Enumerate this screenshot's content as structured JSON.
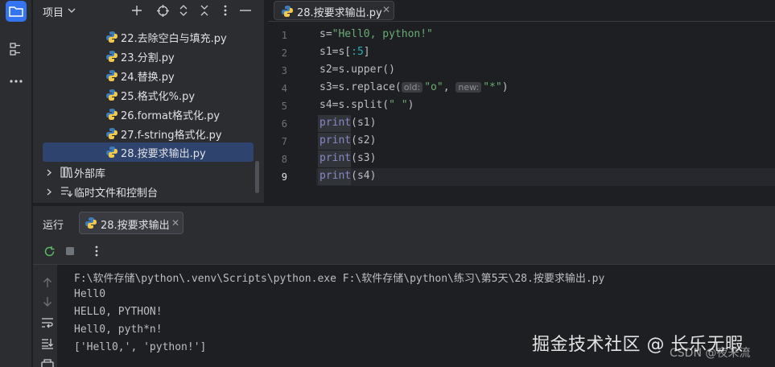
{
  "project_panel": {
    "title": "项目",
    "files": [
      "22.去除空白与填充.py",
      "23.分割.py",
      "24.替换.py",
      "25.格式化%.py",
      "26.format格式化.py",
      "27.f-string格式化.py",
      "28.按要求输出.py"
    ],
    "selected_file": "28.按要求输出.py",
    "external_libs": "外部库",
    "scratches": "临时文件和控制台"
  },
  "editor": {
    "tab_label": "28.按要求输出.py",
    "line_numbers": [
      "1",
      "2",
      "3",
      "4",
      "5",
      "6",
      "7",
      "8",
      "9"
    ],
    "current_line": "9",
    "code": {
      "l1_a": "s=",
      "l1_str": "\"Hell0, python!\"",
      "l2_a": "s1=s[",
      "l2_num": ":5",
      "l2_b": "]",
      "l3": "s2=s.upper()",
      "l4_a": "s3=s.replace(",
      "l4_hint1": "old:",
      "l4_str1": "\"o\"",
      "l4_comma": ",",
      "l4_hint2": "new:",
      "l4_str2": "\"*\"",
      "l4_b": ")",
      "l5_a": "s4=s.split(",
      "l5_str": "\" \"",
      "l5_b": ")",
      "print_kw": "print",
      "l6_arg": "(s1)",
      "l7_arg": "(s2)",
      "l8_arg": "(s3)",
      "l9_arg": "(s4)"
    }
  },
  "run_panel": {
    "title": "运行",
    "tab_label": "28.按要求输出",
    "output": [
      "F:\\软件存储\\python\\.venv\\Scripts\\python.exe F:\\软件存储\\python\\练习\\第5天\\28.按要求输出.py",
      "Hell0",
      "HELL0, PYTHON!",
      "Hell0, pyth*n!",
      "['Hell0,', 'python!']"
    ]
  },
  "watermark": {
    "main": "掘金技术社区 @ 长乐无暇",
    "sub": "CSDN @夜未流"
  },
  "colors": {
    "accent": "#3574f0",
    "selection": "#2e436e",
    "string": "#6aab73",
    "number": "#2aacb8",
    "builtin": "#8888c6"
  },
  "icons": [
    "folder-icon",
    "structure-icon",
    "more-icon",
    "add-icon",
    "locate-icon",
    "expand-icon",
    "collapse-icon",
    "options-icon",
    "hide-icon",
    "python-file-icon",
    "library-icon",
    "scratch-icon",
    "rerun-icon",
    "stop-icon",
    "up-icon",
    "down-icon",
    "soft-wrap-icon",
    "scroll-end-icon",
    "print-icon"
  ]
}
